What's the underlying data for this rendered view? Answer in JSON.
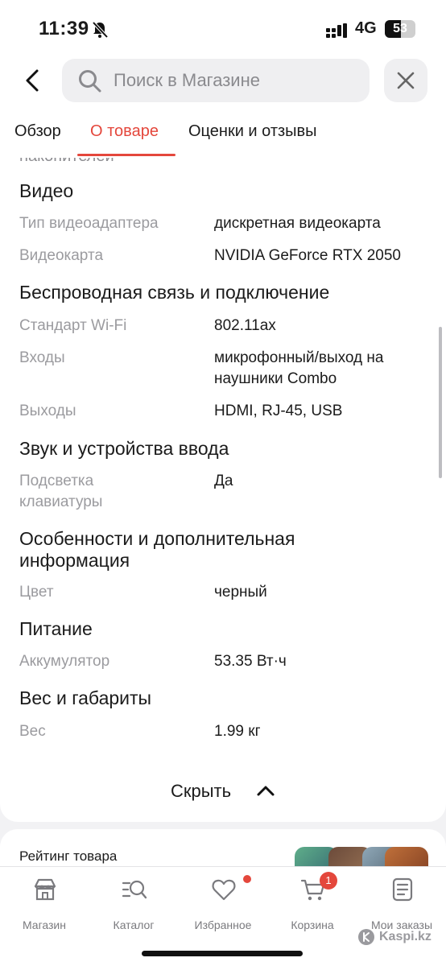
{
  "status_bar": {
    "time": "11:39",
    "network": "4G",
    "battery": "53",
    "battery_level": 0.53
  },
  "header": {
    "search_placeholder": "Поиск в Магазине"
  },
  "tabs": [
    {
      "label": "Обзор",
      "active": false
    },
    {
      "label": "О товаре",
      "active": true
    },
    {
      "label": "Оценки и отзывы",
      "active": false
    }
  ],
  "specs": {
    "cut_off_text": "накопителей",
    "video": {
      "title": "Видео",
      "rows": [
        {
          "label": "Тип видеоадаптера",
          "value": "дискретная видеокарта"
        },
        {
          "label": "Видеокарта",
          "value": "NVIDIA GeForce RTX 2050"
        }
      ]
    },
    "wireless": {
      "title": "Беспроводная связь и подключение",
      "rows": [
        {
          "label": "Стандарт Wi-Fi",
          "value": "802.11ax"
        },
        {
          "label": "Входы",
          "value": "микрофонный/выход на наушники Combo"
        },
        {
          "label": "Выходы",
          "value": "HDMI, RJ-45, USB"
        }
      ]
    },
    "sound": {
      "title": "Звук и устройства ввода",
      "rows": [
        {
          "label": "Подсветка клавиатуры",
          "value": "Да"
        }
      ]
    },
    "features": {
      "title": "Особенности и дополнительная информация",
      "rows": [
        {
          "label": "Цвет",
          "value": "черный"
        }
      ]
    },
    "power": {
      "title": "Питание",
      "rows": [
        {
          "label": "Аккумулятор",
          "value": "53.35 Вт·ч"
        }
      ]
    },
    "weight": {
      "title": "Вес и габариты",
      "rows": [
        {
          "label": "Вес",
          "value": "1.99 кг"
        }
      ]
    },
    "hide_label": "Скрыть"
  },
  "rating": {
    "title": "Рейтинг товара"
  },
  "bottom_nav": {
    "items": [
      {
        "label": "Магазин",
        "icon": "store-icon"
      },
      {
        "label": "Каталог",
        "icon": "catalog-search-icon"
      },
      {
        "label": "Избранное",
        "icon": "heart-icon",
        "has_dot": true
      },
      {
        "label": "Корзина",
        "icon": "cart-icon",
        "badge": "1"
      },
      {
        "label": "Мои заказы",
        "icon": "orders-icon"
      }
    ],
    "brand": "Kaspi.kz"
  },
  "colors": {
    "accent": "#e4473c",
    "label_gray": "#9b9b9f",
    "background": "#f2f2f4"
  }
}
